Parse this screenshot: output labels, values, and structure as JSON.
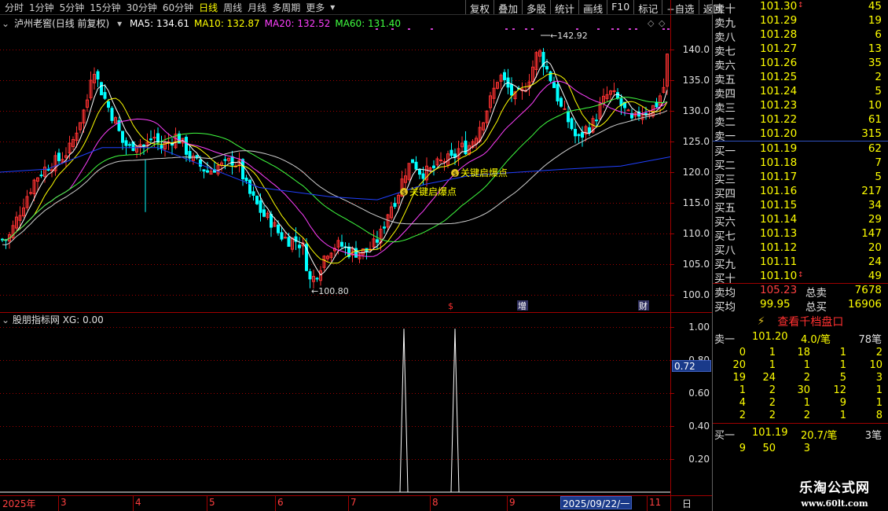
{
  "period_bar": {
    "items": [
      "分时",
      "1分钟",
      "5分钟",
      "15分钟",
      "30分钟",
      "60分钟",
      "日线",
      "周线",
      "月线",
      "多周期",
      "更多"
    ],
    "active": "日线"
  },
  "toolbar": {
    "items": [
      "复权",
      "叠加",
      "多股",
      "统计",
      "画线",
      "F10",
      "标记",
      "+自选",
      "返回"
    ]
  },
  "stock": {
    "title": "泸州老窖(日线 前复权)"
  },
  "ma_legend": [
    {
      "label": "MA5: 134.61",
      "color": "#ffffff"
    },
    {
      "label": "MA10: 132.87",
      "color": "#ffff00"
    },
    {
      "label": "MA20: 132.52",
      "color": "#ff40ff"
    },
    {
      "label": "MA60: 131.40",
      "color": "#40ff40"
    }
  ],
  "price_axis": [
    "140.0",
    "135.0",
    "130.0",
    "125.0",
    "120.0",
    "115.0",
    "110.0",
    "105.0",
    "100.0"
  ],
  "annotations": {
    "high": "142.92",
    "low": "100.80",
    "signal_1": "关键启爆点",
    "signal_2": "关键启爆点",
    "marker_s": "$",
    "marker_zeng": "增",
    "marker_cai": "财"
  },
  "indicator": {
    "title": "股朋指标网 XG: 0.00",
    "axis": [
      "1.00",
      "0.80",
      "0.60",
      "0.40",
      "0.20"
    ],
    "current": "0.72"
  },
  "quote_sell": [
    {
      "label": "卖十",
      "price": "101.30",
      "vol": "45"
    },
    {
      "label": "卖九",
      "price": "101.29",
      "vol": "19"
    },
    {
      "label": "卖八",
      "price": "101.28",
      "vol": "6"
    },
    {
      "label": "卖七",
      "price": "101.27",
      "vol": "13"
    },
    {
      "label": "卖六",
      "price": "101.26",
      "vol": "35"
    },
    {
      "label": "卖五",
      "price": "101.25",
      "vol": "2"
    },
    {
      "label": "卖四",
      "price": "101.24",
      "vol": "5"
    },
    {
      "label": "卖三",
      "price": "101.23",
      "vol": "10"
    },
    {
      "label": "卖二",
      "price": "101.22",
      "vol": "61"
    },
    {
      "label": "卖一",
      "price": "101.20",
      "vol": "315"
    }
  ],
  "quote_buy": [
    {
      "label": "买一",
      "price": "101.19",
      "vol": "62"
    },
    {
      "label": "买二",
      "price": "101.18",
      "vol": "7"
    },
    {
      "label": "买三",
      "price": "101.17",
      "vol": "5"
    },
    {
      "label": "买四",
      "price": "101.16",
      "vol": "217"
    },
    {
      "label": "买五",
      "price": "101.15",
      "vol": "34"
    },
    {
      "label": "买六",
      "price": "101.14",
      "vol": "29"
    },
    {
      "label": "买七",
      "price": "101.13",
      "vol": "147"
    },
    {
      "label": "买八",
      "price": "101.12",
      "vol": "20"
    },
    {
      "label": "买九",
      "price": "101.11",
      "vol": "24"
    },
    {
      "label": "买十",
      "price": "101.10",
      "vol": "49"
    }
  ],
  "summary": {
    "sell_avg_label": "卖均",
    "sell_avg": "105.23",
    "sell_total_label": "总卖",
    "sell_total": "7678",
    "buy_avg_label": "买均",
    "buy_avg": "99.95",
    "buy_total_label": "总买",
    "buy_total": "16906"
  },
  "depth": {
    "title": "查看千档盘口",
    "sell_label": "卖一",
    "sell_price": "101.20",
    "sell_avg": "4.0/笔",
    "sell_count": "78笔",
    "sell_rows": [
      [
        "0",
        "1",
        "18",
        "1",
        "2"
      ],
      [
        "20",
        "1",
        "1",
        "1",
        "10"
      ],
      [
        "19",
        "24",
        "2",
        "5",
        "3"
      ],
      [
        "1",
        "2",
        "30",
        "12",
        "1"
      ],
      [
        "4",
        "2",
        "1",
        "9",
        "1"
      ],
      [
        "2",
        "2",
        "2",
        "1",
        "8"
      ]
    ],
    "buy_label": "买一",
    "buy_price": "101.19",
    "buy_avg": "20.7/笔",
    "buy_count": "3笔",
    "buy_rows": [
      [
        "9",
        "50",
        "3"
      ]
    ]
  },
  "bottom_axis": {
    "labels": [
      "2025年",
      "3",
      "4",
      "5",
      "6",
      "7",
      "8",
      "9",
      "11"
    ],
    "cursor_date": "2025/09/22/一",
    "period": "日线"
  },
  "watermark": {
    "line1": "乐淘公式网",
    "line2": "www.60lt.com"
  },
  "colors": {
    "up": "#ff3232",
    "down": "#00ffff",
    "grid": "#a00000",
    "ma5": "#ffffff",
    "ma10": "#ffff00",
    "ma20": "#ff40ff",
    "ma60": "#40ff40",
    "ma_long": "#2040ff"
  }
}
